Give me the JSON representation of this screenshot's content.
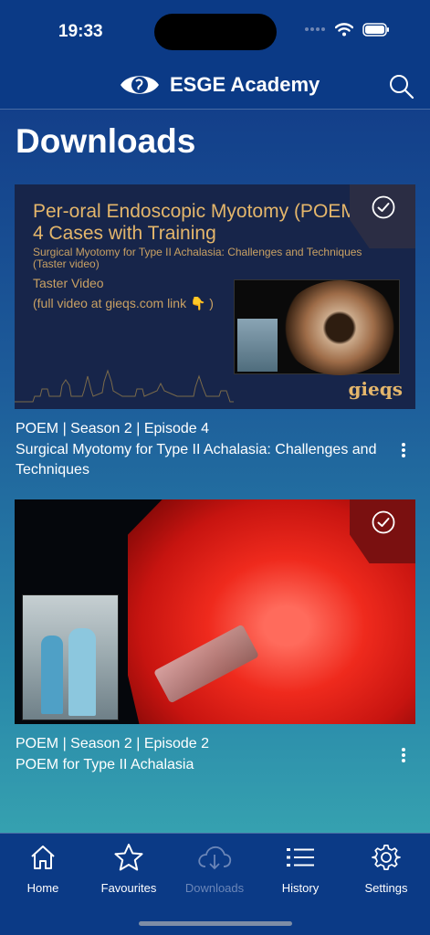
{
  "status_bar": {
    "time": "19:33"
  },
  "header": {
    "title": "ESGE Academy",
    "logo_icon": "esge-logo-icon",
    "search_icon": "search-icon"
  },
  "page": {
    "title": "Downloads"
  },
  "downloads": [
    {
      "thumbnail": {
        "title": "Per-oral Endoscopic Myotomy (POEM) : 4 Cases with Training",
        "subtitle": "Surgical Myotomy for Type II Achalasia: Challenges and Techniques (Taster video)",
        "taster": "Taster Video",
        "full_link": "(full video at gieqs.com link 👇 )",
        "logo": "gieqs"
      },
      "series": "POEM | Season 2 | Episode 4",
      "title": "Surgical Myotomy for Type II Achalasia: Challenges and Techniques",
      "downloaded": true
    },
    {
      "series": "POEM | Season 2 | Episode 2",
      "title": "POEM for Type II Achalasia",
      "downloaded": true
    }
  ],
  "tabbar": {
    "items": [
      {
        "label": "Home",
        "icon": "home-icon"
      },
      {
        "label": "Favourites",
        "icon": "star-icon"
      },
      {
        "label": "Downloads",
        "icon": "cloud-download-icon",
        "active": true
      },
      {
        "label": "History",
        "icon": "list-icon"
      },
      {
        "label": "Settings",
        "icon": "gear-icon"
      }
    ]
  },
  "colors": {
    "header_bg": "#0b3a86",
    "accent_gold": "#e4b66b",
    "inactive_tab": "#6b86b8"
  }
}
